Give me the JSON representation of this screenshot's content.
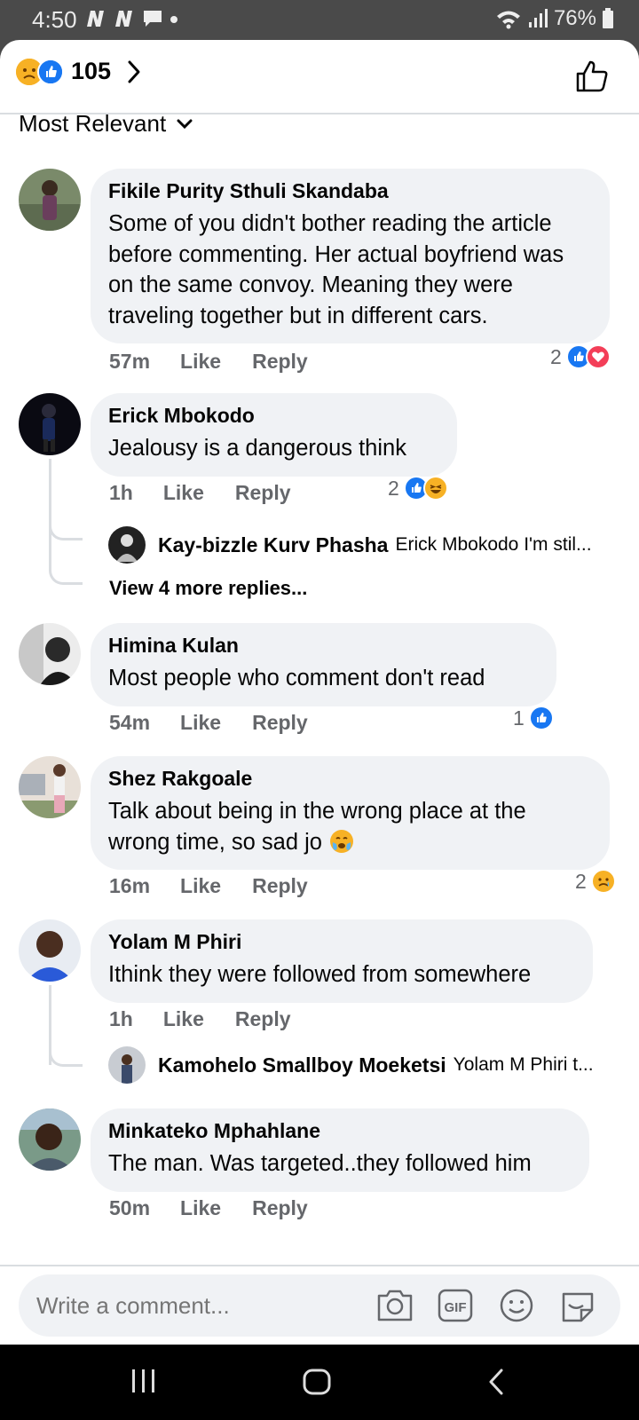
{
  "status": {
    "time": "4:50",
    "battery": "76%"
  },
  "header": {
    "reaction_count": "105"
  },
  "sort": {
    "label": "Most Relevant"
  },
  "comments": [
    {
      "author": "Fikile Purity Sthuli Skandaba",
      "text": "Some of you didn't bother reading the article before commenting. Her actual boyfriend was on the same convoy. Meaning they were traveling together but in different cars.",
      "time": "57m",
      "like": "Like",
      "reply": "Reply",
      "reactions": "2",
      "reaction_icons": [
        "like-icon",
        "love-icon"
      ]
    },
    {
      "author": "Erick Mbokodo",
      "text": "Jealousy is a dangerous think",
      "time": "1h",
      "like": "Like",
      "reply": "Reply",
      "reactions": "2",
      "reaction_icons": [
        "like-icon",
        "haha-icon"
      ],
      "reply_preview": {
        "author": "Kay-bizzle Kurv Phasha",
        "snippet": "Erick Mbokodo I'm stil..."
      },
      "view_more": "View 4 more replies..."
    },
    {
      "author": "Himina Kulan",
      "text": "Most people who comment don't read",
      "time": "54m",
      "like": "Like",
      "reply": "Reply",
      "reactions": "1",
      "reaction_icons": [
        "like-icon"
      ]
    },
    {
      "author": "Shez Rakgoale",
      "text": "Talk about being in the wrong place at the wrong time, so sad jo",
      "time": "16m",
      "like": "Like",
      "reply": "Reply",
      "reactions": "2",
      "reaction_icons": [
        "sad-icon"
      ]
    },
    {
      "author": "Yolam M Phiri",
      "text": "Ithink they were followed from somewhere",
      "time": "1h",
      "like": "Like",
      "reply": "Reply",
      "reply_preview": {
        "author": "Kamohelo Smallboy Moeketsi",
        "snippet": "Yolam M Phiri t..."
      }
    },
    {
      "author": "Minkateko Mphahlane",
      "text": "The man. Was targeted..they followed him",
      "time": "50m",
      "like": "Like",
      "reply": "Reply"
    }
  ],
  "composer": {
    "placeholder": "Write a comment..."
  },
  "colors": {
    "like_blue": "#1877f2",
    "love_red": "#f33e58",
    "emoji_yellow": "#f7b125",
    "bubble_gray": "#f0f2f5",
    "meta_gray": "#65676b"
  }
}
